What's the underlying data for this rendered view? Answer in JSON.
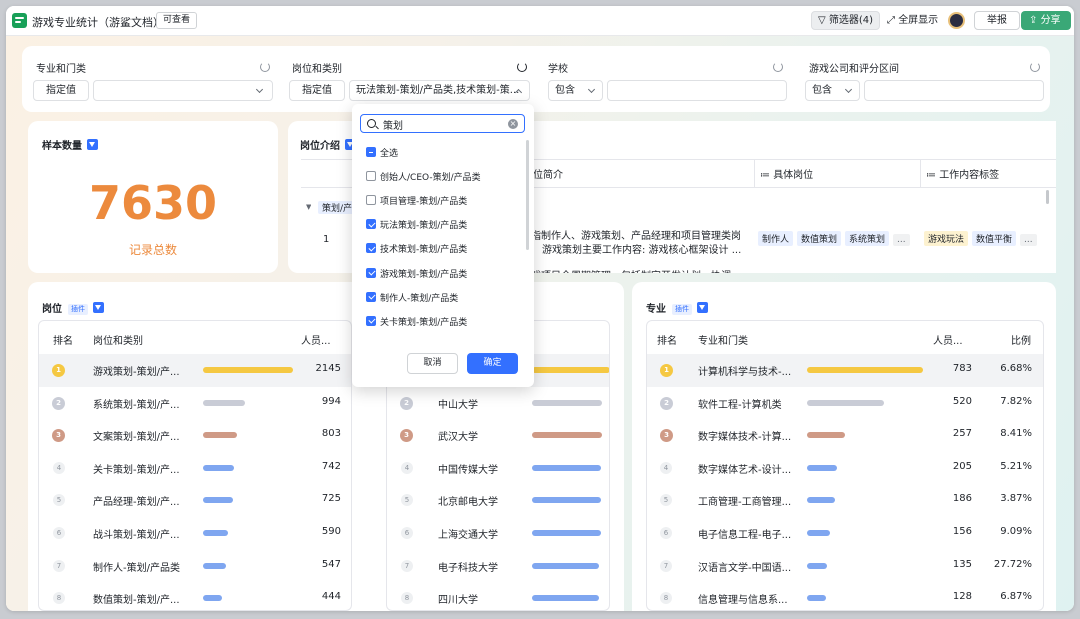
{
  "topbar": {
    "title": "游戏专业统计（游鲨文档）",
    "view_badge": "可查看",
    "filter_label": "筛选器(4)",
    "fullscreen_label": "全屏显示",
    "report_label": "举报",
    "share_label": "分享"
  },
  "filters": {
    "major": {
      "label": "专业和门类",
      "mode": "指定值",
      "value": ""
    },
    "position": {
      "label": "岗位和类别",
      "mode": "指定值",
      "value": "玩法策划-策划/产品类,技术策划-策..."
    },
    "school": {
      "label": "学校",
      "mode": "包含",
      "value": ""
    },
    "company": {
      "label": "游戏公司和评分区间",
      "mode": "包含",
      "value": ""
    }
  },
  "sample": {
    "title": "样本数量",
    "value": "7630",
    "caption": "记录总数"
  },
  "intro": {
    "title": "岗位介绍",
    "col_intro": "职位简介",
    "col_positions": "具体岗位",
    "col_tags": "工作内容标签",
    "group_label": "策划/产",
    "row_index": "1",
    "intro_line1": "是指制作人、游戏策划、产品经理和项目管理类岗",
    "intro_line2": "游戏策划主要工作内容:   游戏核心框架设计 ...",
    "intro_line3": "游戏项目全周期管理，包括制定开发计划，协调",
    "position_tags": [
      "制作人",
      "数值策划",
      "系统策划",
      "..."
    ],
    "content_tags": [
      "游戏玩法",
      "数值平衡",
      "..."
    ]
  },
  "positions_panel": {
    "title": "岗位",
    "plugin": "插件",
    "headers": {
      "rank": "排名",
      "name": "岗位和类别",
      "count": "人员..."
    },
    "rows": [
      {
        "rank": "1",
        "name": "游戏策划-策划/产...",
        "value": 2145
      },
      {
        "rank": "2",
        "name": "系统策划-策划/产...",
        "value": 994
      },
      {
        "rank": "3",
        "name": "文案策划-策划/产...",
        "value": 803
      },
      {
        "rank": "4",
        "name": "关卡策划-策划/产...",
        "value": 742
      },
      {
        "rank": "5",
        "name": "产品经理-策划/产...",
        "value": 725
      },
      {
        "rank": "6",
        "name": "战斗策划-策划/产...",
        "value": 590
      },
      {
        "rank": "7",
        "name": "制作人-策划/产品类",
        "value": 547
      },
      {
        "rank": "8",
        "name": "数值策划-策划/产...",
        "value": 444
      }
    ]
  },
  "schools_panel": {
    "rows": [
      {
        "rank": "1",
        "name": "",
        "value": null
      },
      {
        "rank": "2",
        "name": "中山大学",
        "value": null
      },
      {
        "rank": "3",
        "name": "武汉大学",
        "value": null
      },
      {
        "rank": "4",
        "name": "中国传媒大学",
        "value": null
      },
      {
        "rank": "5",
        "name": "北京邮电大学",
        "value": null
      },
      {
        "rank": "6",
        "name": "上海交通大学",
        "value": null
      },
      {
        "rank": "7",
        "name": "电子科技大学",
        "value": null
      },
      {
        "rank": "8",
        "name": "四川大学",
        "value": null
      }
    ],
    "bar_fractions": [
      1.0,
      0.9,
      0.9,
      0.88,
      0.88,
      0.88,
      0.86,
      0.86
    ]
  },
  "majors_panel": {
    "title": "专业",
    "plugin": "插件",
    "headers": {
      "rank": "排名",
      "name": "专业和门类",
      "count": "人员...",
      "ratio": "比例"
    },
    "rows": [
      {
        "rank": "1",
        "name": "计算机科学与技术-...",
        "value": 783,
        "ratio": "6.68%"
      },
      {
        "rank": "2",
        "name": "软件工程-计算机类",
        "value": 520,
        "ratio": "7.82%"
      },
      {
        "rank": "3",
        "name": "数字媒体技术-计算...",
        "value": 257,
        "ratio": "8.41%"
      },
      {
        "rank": "4",
        "name": "数字媒体艺术-设计...",
        "value": 205,
        "ratio": "5.21%"
      },
      {
        "rank": "5",
        "name": "工商管理-工商管理...",
        "value": 186,
        "ratio": "3.87%"
      },
      {
        "rank": "6",
        "name": "电子信息工程-电子...",
        "value": 156,
        "ratio": "9.09%"
      },
      {
        "rank": "7",
        "name": "汉语言文学-中国语...",
        "value": 135,
        "ratio": "27.72%"
      },
      {
        "rank": "8",
        "name": "信息管理与信息系...",
        "value": 128,
        "ratio": "6.87%"
      }
    ]
  },
  "dropdown": {
    "search_value": "策划",
    "options": [
      {
        "label": "全选",
        "state": "partial"
      },
      {
        "label": "创始人/CEO-策划/产品类",
        "state": "off"
      },
      {
        "label": "项目管理-策划/产品类",
        "state": "off"
      },
      {
        "label": "玩法策划-策划/产品类",
        "state": "on"
      },
      {
        "label": "技术策划-策划/产品类",
        "state": "on"
      },
      {
        "label": "游戏策划-策划/产品类",
        "state": "on"
      },
      {
        "label": "制作人-策划/产品类",
        "state": "on"
      },
      {
        "label": "关卡策划-策划/产品类",
        "state": "on"
      }
    ],
    "cancel_label": "取消",
    "ok_label": "确定"
  },
  "colors": {
    "gold": "#f5c842",
    "silver": "#c9ccd6",
    "bronze": "#cf9a86",
    "bar": "#7fa6f0",
    "accent": "#3370ff",
    "orange": "#ec8a3d"
  }
}
